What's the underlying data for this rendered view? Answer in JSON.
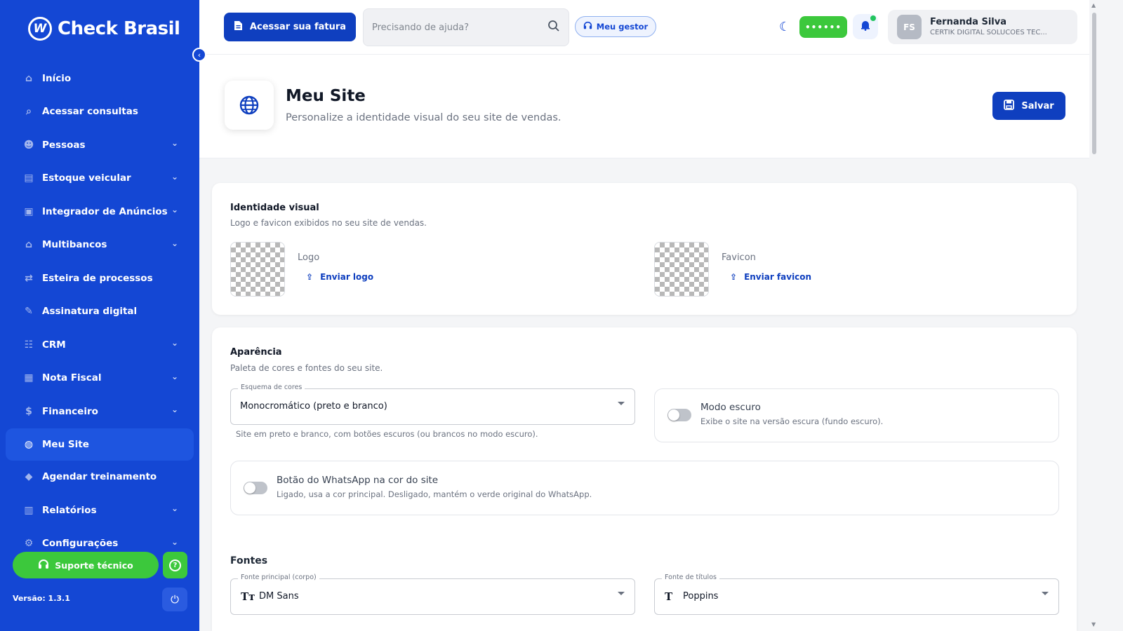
{
  "brand": {
    "name": "Check Brasil"
  },
  "sidebar": {
    "items": [
      {
        "label": "Início",
        "icon": "home-icon",
        "glyph": "⌂",
        "has_children": false
      },
      {
        "label": "Acessar consultas",
        "icon": "search-icon",
        "glyph": "⌕",
        "has_children": false
      },
      {
        "label": "Pessoas",
        "icon": "people-icon",
        "glyph": "☻",
        "has_children": true
      },
      {
        "label": "Estoque veicular",
        "icon": "car-icon",
        "glyph": "▤",
        "has_children": true
      },
      {
        "label": "Integrador de Anúncios",
        "icon": "ads-icon",
        "glyph": "▣",
        "has_children": true
      },
      {
        "label": "Multibancos",
        "icon": "bank-icon",
        "glyph": "⌂",
        "has_children": true
      },
      {
        "label": "Esteira de processos",
        "icon": "process-icon",
        "glyph": "⇄",
        "has_children": false
      },
      {
        "label": "Assinatura digital",
        "icon": "signature-icon",
        "glyph": "✎",
        "has_children": false
      },
      {
        "label": "CRM",
        "icon": "crm-icon",
        "glyph": "☷",
        "has_children": true
      },
      {
        "label": "Nota Fiscal",
        "icon": "invoice-icon",
        "glyph": "▦",
        "has_children": true
      },
      {
        "label": "Financeiro",
        "icon": "finance-icon",
        "glyph": "$",
        "has_children": true
      },
      {
        "label": "Meu Site",
        "icon": "globe-icon",
        "glyph": "◍",
        "has_children": false,
        "active": true
      },
      {
        "label": "Agendar treinamento",
        "icon": "training-icon",
        "glyph": "◆",
        "has_children": false
      },
      {
        "label": "Relatórios",
        "icon": "reports-icon",
        "glyph": "▥",
        "has_children": true
      },
      {
        "label": "Configurações",
        "icon": "settings-icon",
        "glyph": "⚙",
        "has_children": true
      }
    ],
    "support_label": "Suporte técnico",
    "version": "Versão: 1.3.1"
  },
  "header": {
    "invoice_label": "Acessar sua fatura",
    "search_placeholder": "Precisando de ajuda?",
    "gestor_label": "Meu gestor",
    "masked_value": "••••••",
    "user": {
      "initials": "FS",
      "name": "Fernanda Silva",
      "company": "CERTIK DIGITAL SOLUCOES TEC..."
    }
  },
  "page": {
    "title": "Meu Site",
    "subtitle": "Personalize a identidade visual do seu site de vendas.",
    "save_label": "Salvar"
  },
  "identity": {
    "title": "Identidade visual",
    "description": "Logo e favicon exibidos no seu site de vendas.",
    "logo_label": "Logo",
    "logo_upload": "Enviar logo",
    "favicon_label": "Favicon",
    "favicon_upload": "Enviar favicon"
  },
  "appearance": {
    "title": "Aparência",
    "description": "Paleta de cores e fontes do seu site.",
    "color_scheme": {
      "legend": "Esquema de cores",
      "value": "Monocromático (preto e branco)",
      "helper": "Site em preto e branco, com botões escuros (ou brancos no modo escuro)."
    },
    "dark_mode": {
      "title": "Modo escuro",
      "description": "Exibe o site na versão escura (fundo escuro).",
      "enabled": false
    },
    "whatsapp": {
      "title": "Botão do WhatsApp na cor do site",
      "description": "Ligado, usa a cor principal. Desligado, mantém o verde original do WhatsApp.",
      "enabled": false
    },
    "fonts_label": "Fontes",
    "body_font": {
      "legend": "Fonte principal (corpo)",
      "value": "DM Sans"
    },
    "title_font": {
      "legend": "Fonte de títulos",
      "value": "Poppins"
    }
  },
  "colors": {
    "sidebar": "#1447d4",
    "primary": "#0f3fbf",
    "success": "#3cc83c"
  }
}
